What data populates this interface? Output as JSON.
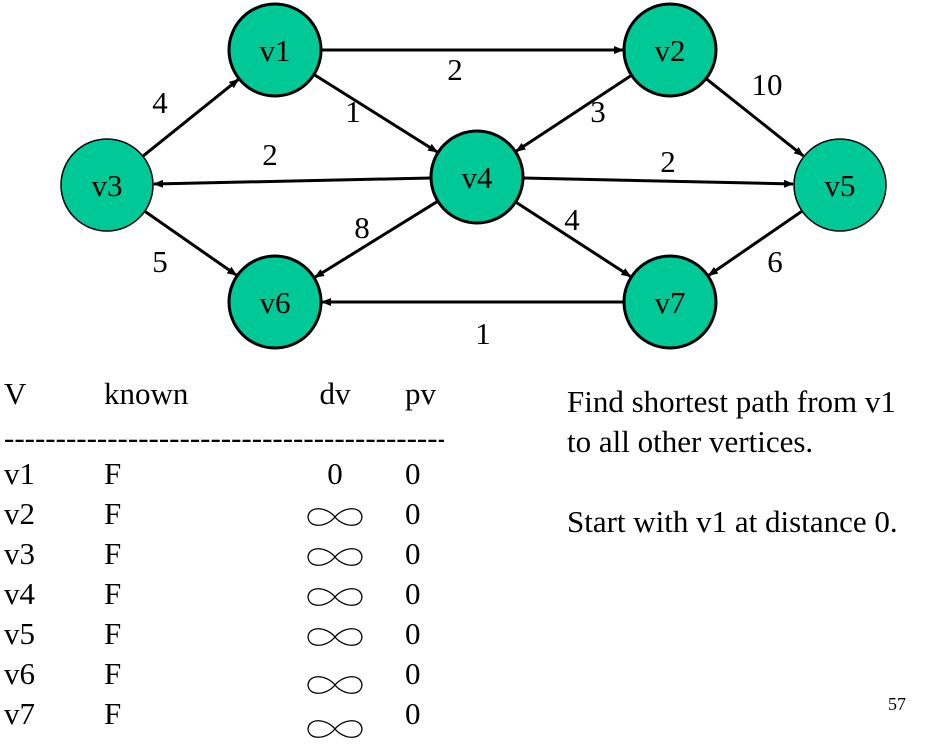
{
  "colors": {
    "node_fill": "#00C896",
    "stroke": "#000000"
  },
  "graph": {
    "nodes": [
      {
        "id": "v1",
        "label": "v1"
      },
      {
        "id": "v2",
        "label": "v2"
      },
      {
        "id": "v3",
        "label": "v3"
      },
      {
        "id": "v4",
        "label": "v4"
      },
      {
        "id": "v5",
        "label": "v5"
      },
      {
        "id": "v6",
        "label": "v6"
      },
      {
        "id": "v7",
        "label": "v7"
      }
    ],
    "edges": [
      {
        "from": "v1",
        "to": "v2",
        "weight": "2"
      },
      {
        "from": "v1",
        "to": "v4",
        "weight": "1"
      },
      {
        "from": "v2",
        "to": "v4",
        "weight": "3"
      },
      {
        "from": "v2",
        "to": "v5",
        "weight": "10"
      },
      {
        "from": "v3",
        "to": "v1",
        "weight": "4"
      },
      {
        "from": "v3",
        "to": "v6",
        "weight": "5"
      },
      {
        "from": "v4",
        "to": "v3",
        "weight": "2"
      },
      {
        "from": "v4",
        "to": "v5",
        "weight": "2"
      },
      {
        "from": "v4",
        "to": "v6",
        "weight": "8"
      },
      {
        "from": "v4",
        "to": "v7",
        "weight": "4"
      },
      {
        "from": "v5",
        "to": "v7",
        "weight": "6"
      },
      {
        "from": "v7",
        "to": "v6",
        "weight": "1"
      }
    ]
  },
  "table": {
    "headers": {
      "v": "V",
      "known": "known",
      "dv": "dv",
      "pv": "pv"
    },
    "separator": "-------------------------------------------",
    "rows": [
      {
        "v": "v1",
        "known": "F",
        "dv": "0",
        "pv": "0"
      },
      {
        "v": "v2",
        "known": "F",
        "dv": "∞",
        "pv": "0"
      },
      {
        "v": "v3",
        "known": "F",
        "dv": "∞",
        "pv": "0"
      },
      {
        "v": "v4",
        "known": "F",
        "dv": "∞",
        "pv": "0"
      },
      {
        "v": "v5",
        "known": "F",
        "dv": "∞",
        "pv": "0"
      },
      {
        "v": "v6",
        "known": "F",
        "dv": "∞",
        "pv": "0"
      },
      {
        "v": "v7",
        "known": "F",
        "dv": "∞",
        "pv": "0"
      }
    ]
  },
  "description": {
    "line1": "Find shortest path from v1",
    "line2": "to all other vertices.",
    "line3": "Start with v1 at distance 0."
  },
  "page_number": "57"
}
